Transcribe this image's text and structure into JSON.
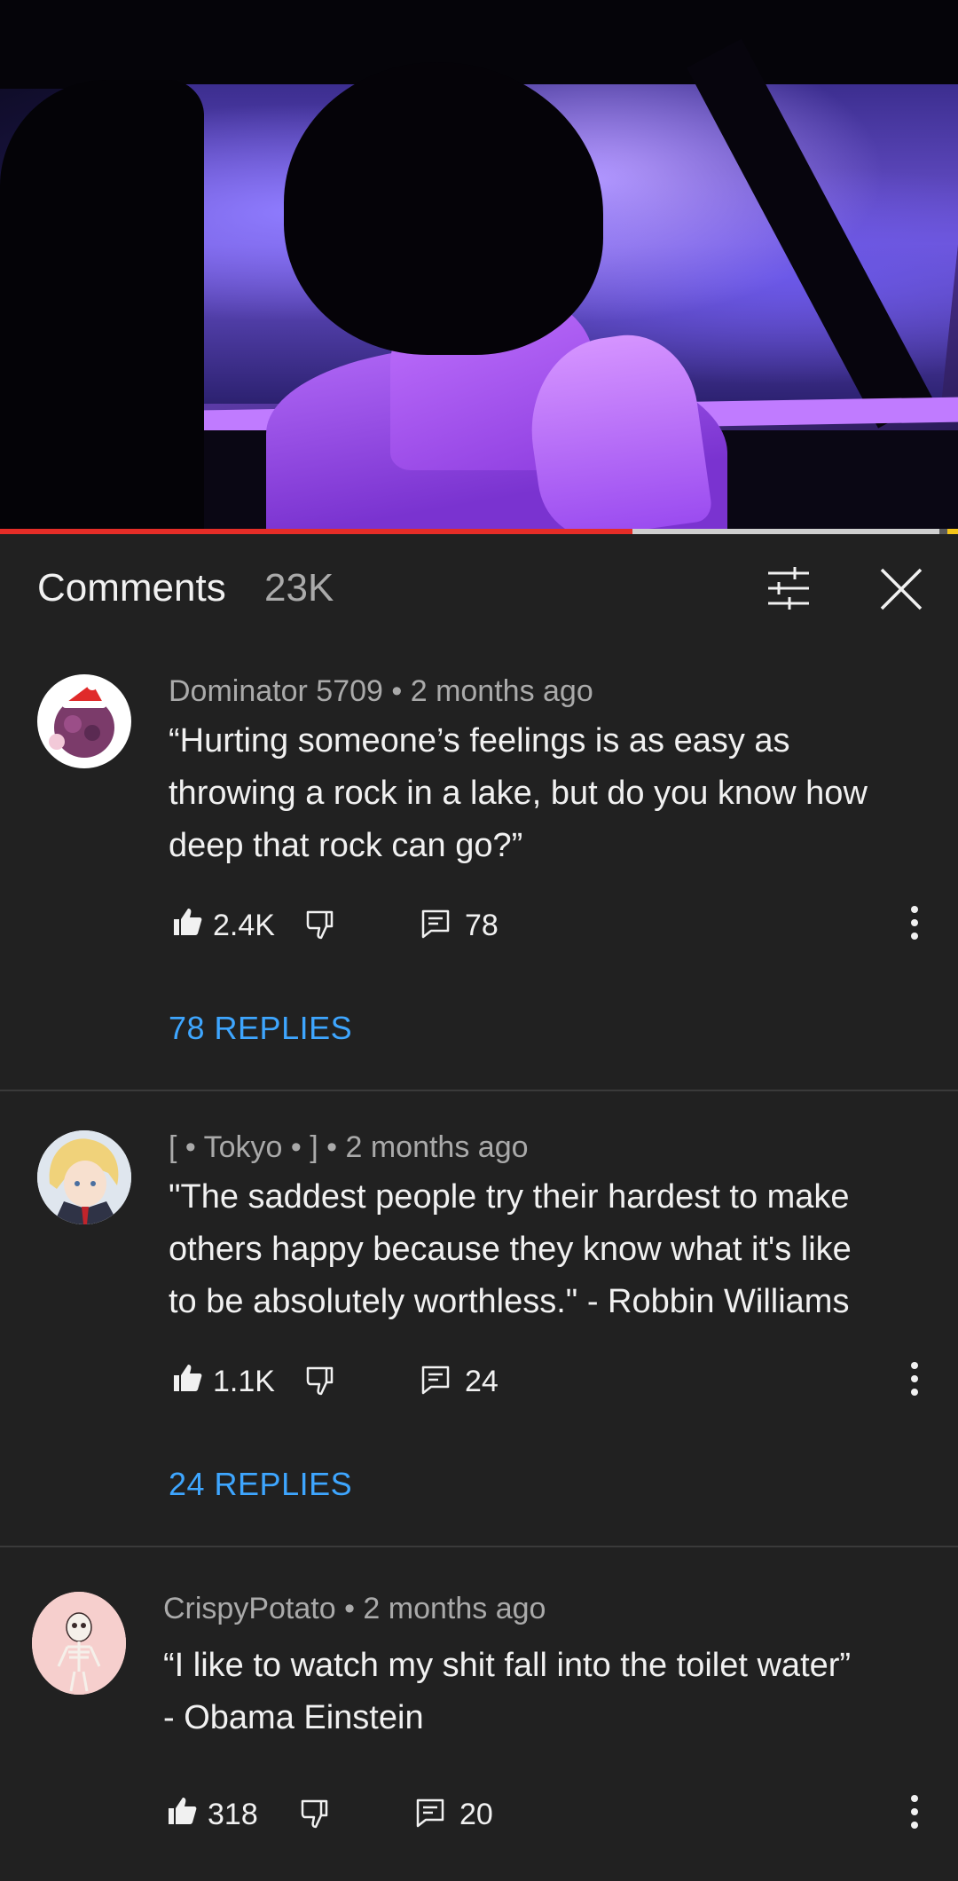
{
  "player": {
    "progress_played_fraction": 0.66,
    "progress_buffered_fraction": 0.98
  },
  "header": {
    "title": "Comments",
    "count": "23K",
    "filter_icon": "filter-icon",
    "close_icon": "close-icon"
  },
  "comments": [
    {
      "author": "Dominator 5709",
      "time": "2 months ago",
      "meta": "Dominator 5709 • 2 months ago",
      "lines": [
        "“Hurting someone’s feelings is as easy as",
        "throwing a rock in a lake, but do you know how",
        "deep that rock can go?”"
      ],
      "likes": "2.4K",
      "reply_count": "78",
      "replies_label": "78 REPLIES"
    },
    {
      "author": "[ • Tokyo • ]",
      "time": "2 months ago",
      "meta": "[ • Tokyo • ] • 2 months ago",
      "lines": [
        "\"The saddest people try their hardest to make",
        "others happy because they know what it's like",
        "to be absolutely worthless.\" - Robbin Williams"
      ],
      "likes": "1.1K",
      "reply_count": "24",
      "replies_label": "24 REPLIES"
    },
    {
      "author": "CrispyPotato",
      "time": "2 months ago",
      "meta": "CrispyPotato • 2 months ago",
      "lines": [
        "“I like to watch my shit fall into the toilet water”",
        "- Obama Einstein"
      ],
      "likes": "318",
      "reply_count": "20"
    }
  ],
  "colors": {
    "background": "#212121",
    "accent_link": "#3ea6ff",
    "progress_red": "#e52d27",
    "secondary_text": "#aaaaaa"
  }
}
